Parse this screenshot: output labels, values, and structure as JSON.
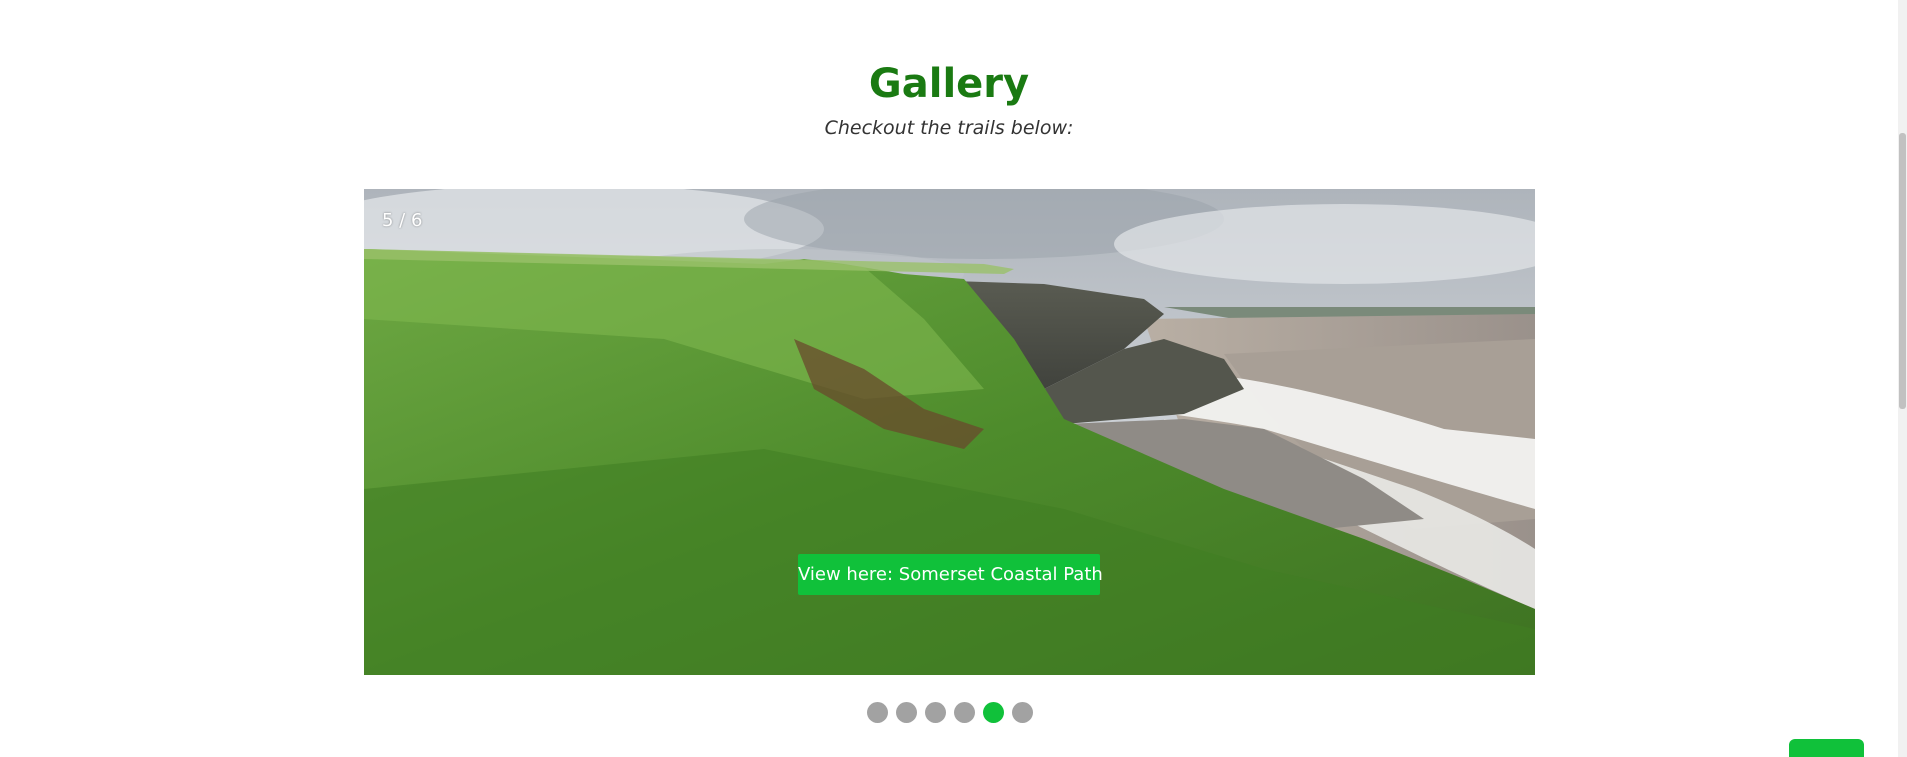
{
  "gallery": {
    "title": "Gallery",
    "subtitle": "Checkout the trails below:"
  },
  "slideshow": {
    "counter": "5 / 6",
    "caption_button": "View here: Somerset Coastal Path",
    "current_slide": 5,
    "total_slides": 6,
    "image_subject": "grassy clifftop above a rocky beach and sea"
  },
  "colors": {
    "title_green": "#1a7a12",
    "accent_green": "#10c13a",
    "dot_inactive": "#a2a2a2"
  },
  "dots": [
    {
      "index": 1,
      "active": false
    },
    {
      "index": 2,
      "active": false
    },
    {
      "index": 3,
      "active": false
    },
    {
      "index": 4,
      "active": false
    },
    {
      "index": 5,
      "active": true
    },
    {
      "index": 6,
      "active": false
    }
  ]
}
